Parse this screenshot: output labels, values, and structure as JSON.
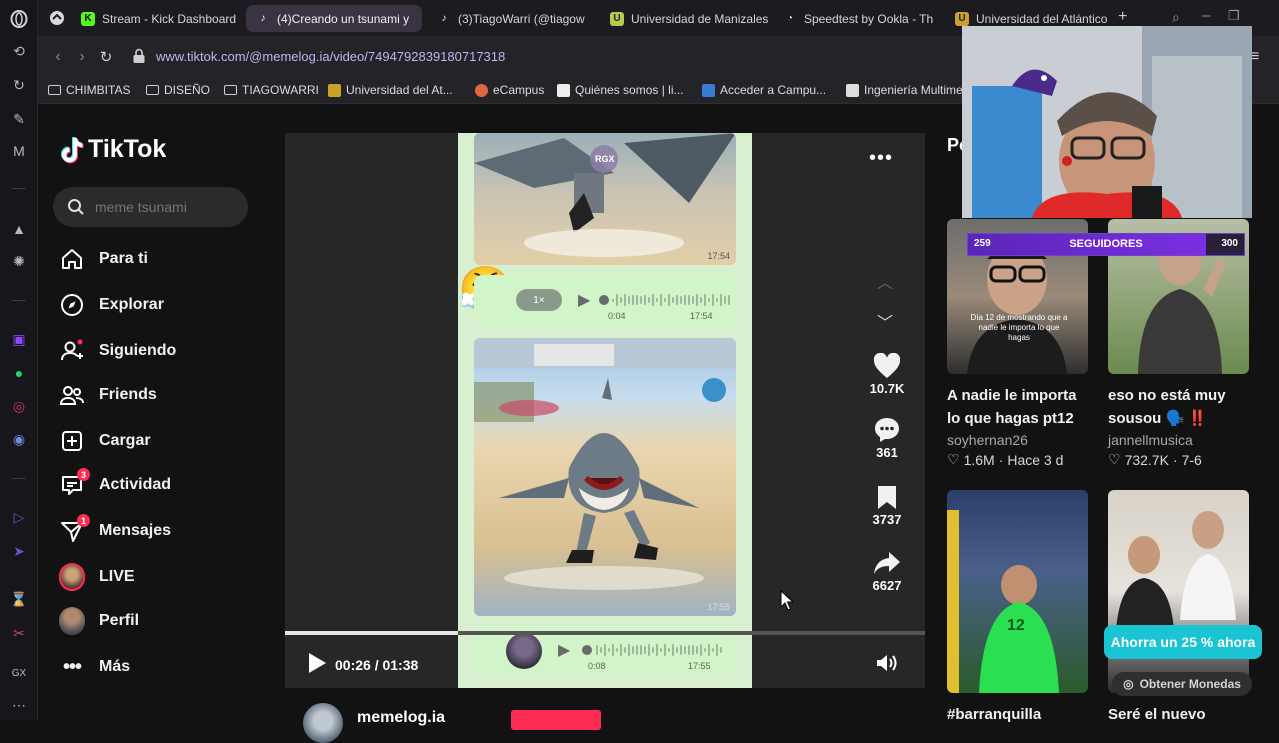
{
  "browser": {
    "tabs": [
      {
        "label": "Stream - Kick Dashboard",
        "favicon": "kick-icon",
        "color": "#53fc18"
      },
      {
        "label": "(4)Creando un tsunami y",
        "favicon": "tiktok-icon",
        "active": true
      },
      {
        "label": "(3)TiagoWarri (@tiagow",
        "favicon": "tiktok-icon"
      },
      {
        "label": "Universidad de Manizales",
        "favicon": "umanizales-icon"
      },
      {
        "label": "Speedtest by Ookla - Th",
        "favicon": "speedtest-icon"
      },
      {
        "label": "Universidad del Atlántico",
        "favicon": "uatlantico-icon"
      }
    ],
    "new_tab": "+",
    "url": "www.tiktok.com/@memelog.ia/video/7494792839180717318",
    "bookmarks": [
      {
        "label": "CHIMBITAS",
        "type": "folder"
      },
      {
        "label": "DISEÑO",
        "type": "folder"
      },
      {
        "label": "TIAGOWARRI",
        "type": "folder"
      },
      {
        "label": "Universidad del At...",
        "type": "site"
      },
      {
        "label": "eCampus",
        "type": "site"
      },
      {
        "label": "Quiénes somos | li...",
        "type": "site"
      },
      {
        "label": "Acceder a Campu...",
        "type": "site"
      },
      {
        "label": "Ingeniería Multime",
        "type": "site"
      }
    ]
  },
  "tiktok": {
    "logo": "TikTok",
    "search_placeholder": "meme tsunami",
    "nav": [
      {
        "label": "Para ti",
        "icon": "home-icon"
      },
      {
        "label": "Explorar",
        "icon": "compass-icon"
      },
      {
        "label": "Siguiendo",
        "icon": "following-icon"
      },
      {
        "label": "Friends",
        "icon": "friends-icon"
      },
      {
        "label": "Cargar",
        "icon": "upload-icon"
      },
      {
        "label": "Actividad",
        "icon": "activity-icon",
        "badge": "3"
      },
      {
        "label": "Mensajes",
        "icon": "messages-icon",
        "badge": "1"
      },
      {
        "label": "LIVE",
        "icon": "live-avatar"
      },
      {
        "label": "Perfil",
        "icon": "profile-avatar"
      },
      {
        "label": "Más",
        "icon": "more-icon"
      }
    ],
    "player": {
      "time": "00:26 / 01:38",
      "progress": 0.27,
      "watermark": "RGX",
      "msg1_time": "17:54",
      "audio1": {
        "speed": "1×",
        "duration": "0:04",
        "time": "17:54"
      },
      "msg2_time": "17:55",
      "audio2": {
        "duration": "0:08",
        "time": "17:55"
      }
    },
    "actions": {
      "likes": "10.7K",
      "comments": "361",
      "saves": "3737",
      "shares": "6627"
    },
    "author": "memelog.ia",
    "right_heading": "Po",
    "recommendations": [
      {
        "title": "A nadie le importa lo que hagas pt12 #fy...",
        "user": "soyhernan26",
        "likes": "1.6M",
        "when": "Hace 3 d",
        "caption": "Día 12 de mostrando que a nadie le importa lo que hagas"
      },
      {
        "title": "eso no está muy sousou 🗣️ ‼️",
        "user": "jannellmusica",
        "likes": "732.7K",
        "when": "7-6"
      },
      {
        "title": "#barranquilla",
        "user": "",
        "likes": "",
        "when": ""
      },
      {
        "title": "Seré el nuevo",
        "user": "",
        "likes": "",
        "when": ""
      }
    ],
    "promo": "Ahorra un 25 % ahora",
    "coins": "Obtener Monedas"
  },
  "stream_overlay": {
    "sub_current": "259",
    "sub_label": "SEGUIDORES",
    "sub_goal": "300",
    "sub_progress": 0.863
  },
  "colors": {
    "accent": "#fe2c55",
    "promo": "#1ac4d3",
    "subgoal": "#7b2fe0"
  }
}
